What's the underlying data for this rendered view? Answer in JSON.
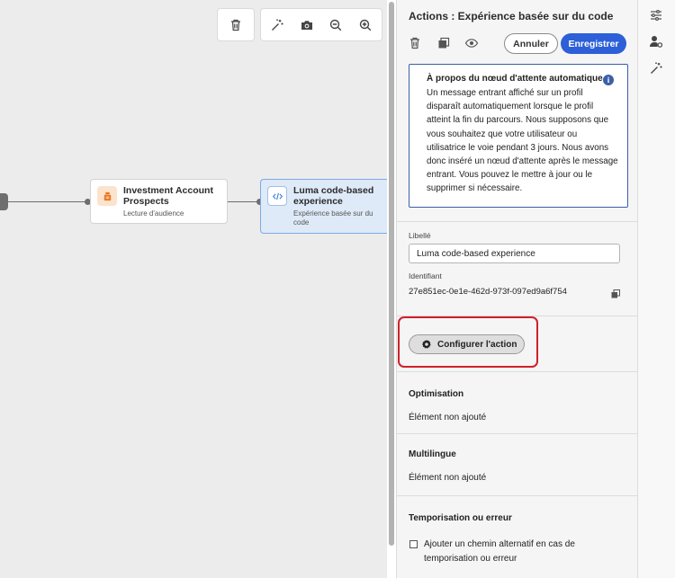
{
  "canvas": {
    "toolbar": {
      "delete_icon": "trash-icon",
      "tools": [
        "magic-wand-icon",
        "camera-icon",
        "zoom-out-icon",
        "zoom-in-icon"
      ]
    },
    "nodes": [
      {
        "title": "Investment Account Prospects",
        "subtitle": "Lecture d'audience",
        "icon": "audience-icon",
        "icon_color": "#e8761e"
      },
      {
        "title": "Luma code-based experience",
        "subtitle": "Expérience basée sur du code",
        "icon": "code-icon",
        "icon_color": "#3f7fd6"
      }
    ]
  },
  "panel": {
    "title": "Actions : Expérience basée sur du code",
    "actions": {
      "cancel_label": "Annuler",
      "save_label": "Enregistrer"
    },
    "info": {
      "title": "À propos du nœud d'attente automatique",
      "body": "Un message entrant affiché sur un profil disparaît automatiquement lorsque le profil atteint la fin du parcours. Nous supposons que vous souhaitez que votre utilisateur ou utilisatrice le voie pendant 3 jours. Nous avons donc inséré un nœud d'attente après le message entrant. Vous pouvez le mettre à jour ou le supprimer si nécessaire."
    },
    "label_field": {
      "label": "Libellé",
      "value": "Luma code-based experience"
    },
    "id_field": {
      "label": "Identifiant",
      "value": "27e851ec-0e1e-462d-973f-097ed9a6f754"
    },
    "configure_label": "Configurer l'action",
    "optimisation": {
      "title": "Optimisation",
      "value": "Élément non ajouté"
    },
    "multilingual": {
      "title": "Multilingue",
      "value": "Élément non ajouté"
    },
    "timeout": {
      "title": "Temporisation ou erreur",
      "checkbox_label": "Ajouter un chemin alternatif en cas de temporisation ou erreur",
      "checked": false
    }
  },
  "rail": {
    "icons": [
      "sliders-icon",
      "user-settings-icon",
      "magic-wand-icon"
    ]
  },
  "colors": {
    "primary": "#2d5fd8",
    "highlight": "#d0202b",
    "info_border": "#3c5fa8",
    "selected_node": "#deeaf8"
  }
}
